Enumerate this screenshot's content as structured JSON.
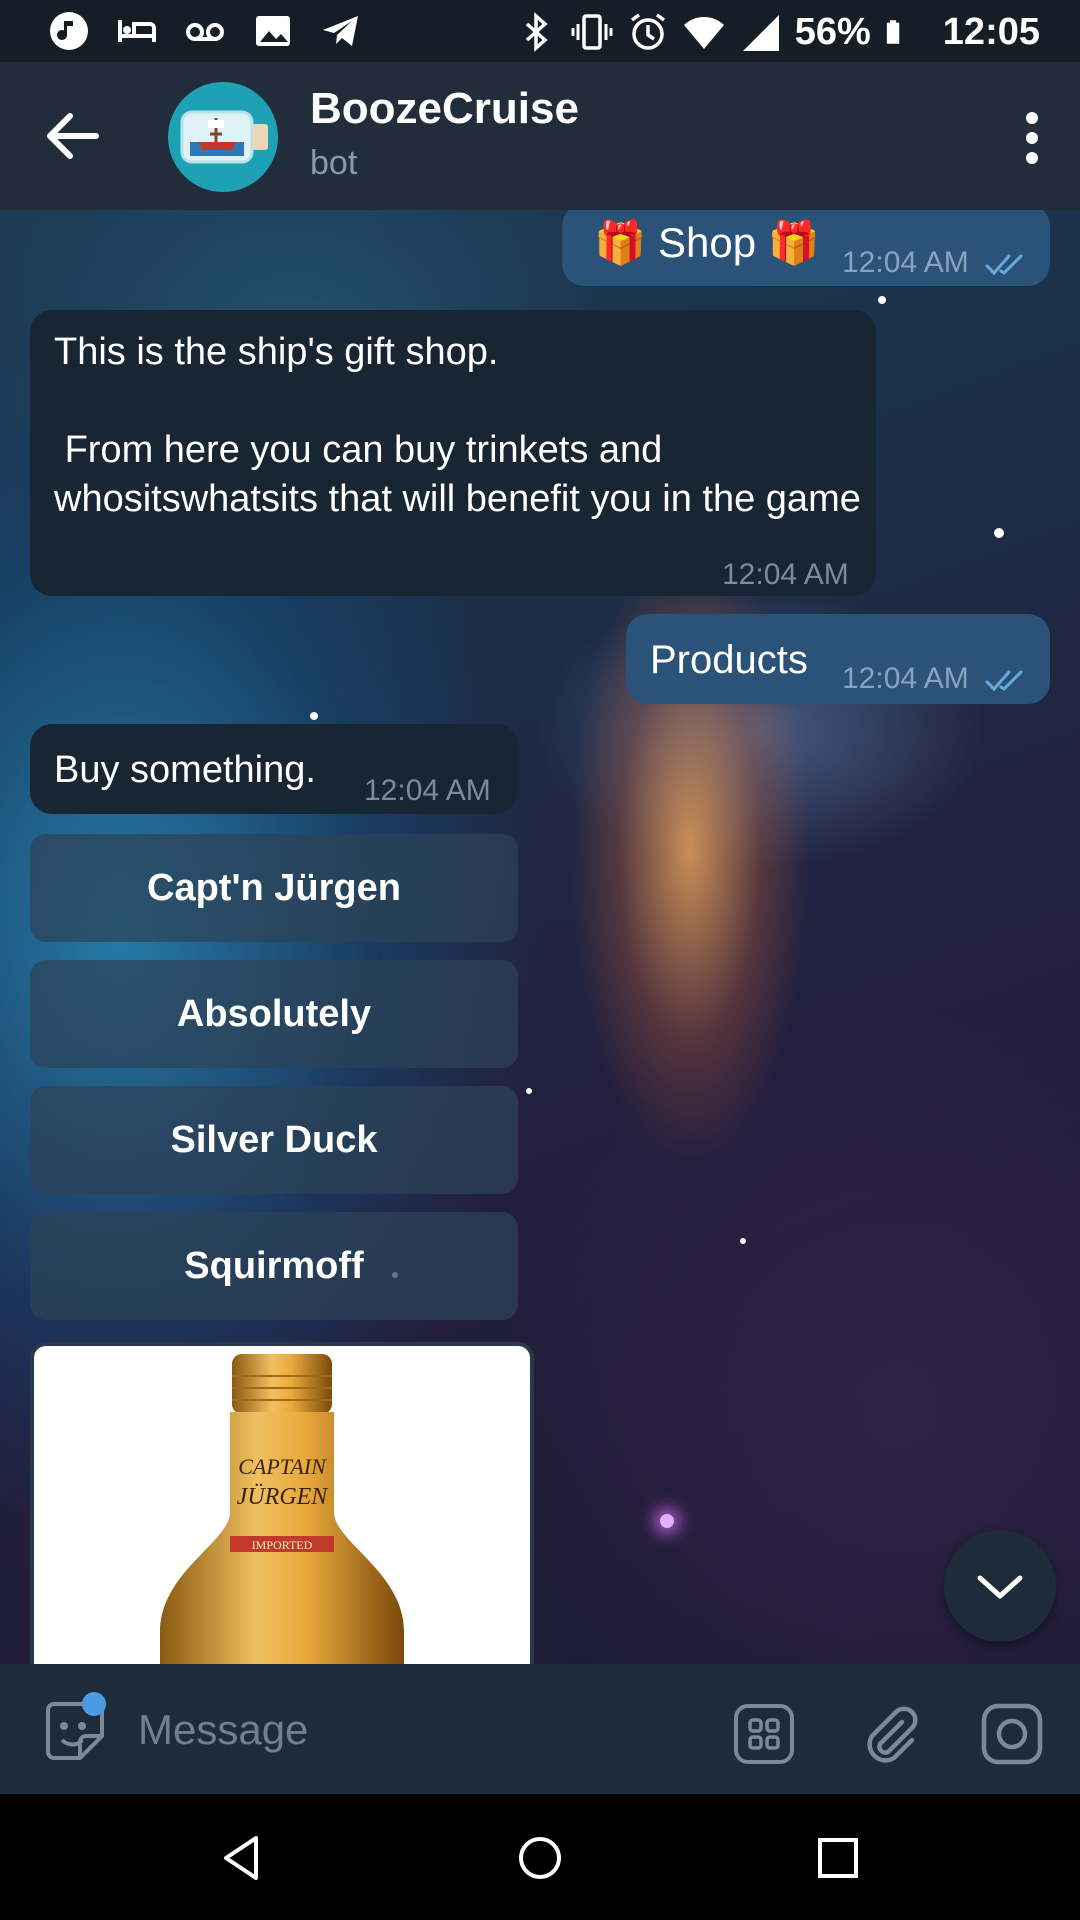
{
  "status_bar": {
    "battery": "56%",
    "time": "12:05",
    "left_icons": [
      "music-icon",
      "bed-icon",
      "voicemail-icon",
      "image-icon",
      "telegram-icon"
    ],
    "right_icons": [
      "bluetooth-icon",
      "vibrate-icon",
      "alarm-icon",
      "wifi-icon",
      "signal-icon",
      "battery-icon"
    ]
  },
  "header": {
    "title": "BoozeCruise",
    "subtitle": "bot"
  },
  "messages": [
    {
      "direction": "out",
      "text": "🎁 Shop 🎁",
      "time": "12:04 AM",
      "read": true
    },
    {
      "direction": "in",
      "line1": "This is the ship's gift shop.",
      "line2": " From here you can buy trinkets and whositswhatsits that will benefit you in the game",
      "time": "12:04 AM"
    },
    {
      "direction": "out",
      "text": "Products",
      "time": "12:04 AM",
      "read": true
    },
    {
      "direction": "in",
      "text": "Buy something.",
      "time": "12:04 AM"
    }
  ],
  "keyboard_buttons": [
    "Capt'n Jürgen",
    "Absolutely",
    "Silver Duck",
    "Squirmoff"
  ],
  "photo": {
    "label_line1": "CAPTAIN",
    "label_line2": "JÜRGEN",
    "label_line3": "IMPORTED"
  },
  "input": {
    "placeholder": "Message"
  },
  "colors": {
    "header_bg": "#212d3b",
    "outgoing_bubble": "#2b5278",
    "incoming_bubble": "#182533",
    "input_bar": "#1e2c3a",
    "accent": "#4b9be3"
  }
}
